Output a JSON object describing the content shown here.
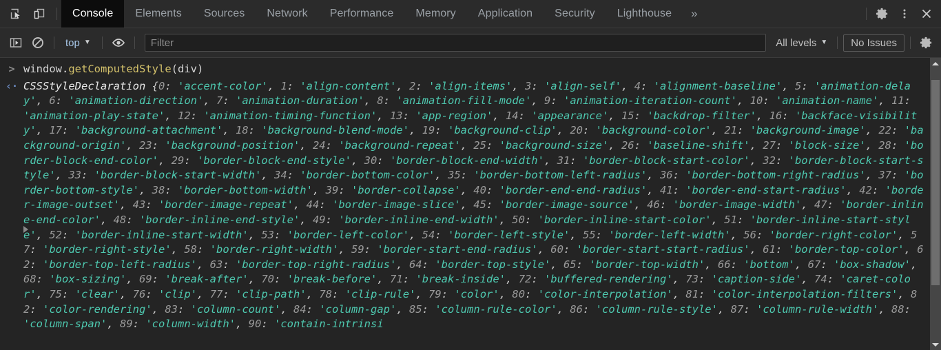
{
  "tabbar": {
    "inspect_icon": "inspect-element-icon",
    "device_icon": "device-toolbar-icon",
    "tabs": [
      {
        "label": "Console",
        "active": true
      },
      {
        "label": "Elements",
        "active": false
      },
      {
        "label": "Sources",
        "active": false
      },
      {
        "label": "Network",
        "active": false
      },
      {
        "label": "Performance",
        "active": false
      },
      {
        "label": "Memory",
        "active": false
      },
      {
        "label": "Application",
        "active": false
      },
      {
        "label": "Security",
        "active": false
      },
      {
        "label": "Lighthouse",
        "active": false
      }
    ],
    "more_tabs_label": "»",
    "settings_icon": "gear-icon",
    "more_options_icon": "kebab-menu-icon",
    "close_icon": "close-icon"
  },
  "toolbar": {
    "sidebar_icon": "console-sidebar-icon",
    "clear_icon": "clear-console-icon",
    "context_label": "top",
    "context_caret": "▼",
    "eye_icon": "live-expression-eye-icon",
    "filter_placeholder": "Filter",
    "filter_value": "",
    "levels_label": "All levels",
    "levels_caret": "▼",
    "issues_label": "No Issues",
    "settings_icon": "console-settings-gear-icon"
  },
  "console": {
    "prompt_symbol": ">",
    "response_symbol": "‹·",
    "command": {
      "object": "window",
      "dot": ".",
      "method": "getComputedStyle",
      "args": "(div)"
    },
    "result": {
      "constructor": "CSSStyleDeclaration ",
      "open_brace": "{",
      "entries": [
        {
          "index": "0",
          "value": "accent-color"
        },
        {
          "index": "1",
          "value": "align-content"
        },
        {
          "index": "2",
          "value": "align-items"
        },
        {
          "index": "3",
          "value": "align-self"
        },
        {
          "index": "4",
          "value": "alignment-baseline"
        },
        {
          "index": "5",
          "value": "animation-delay"
        },
        {
          "index": "6",
          "value": "animation-direction"
        },
        {
          "index": "7",
          "value": "animation-duration"
        },
        {
          "index": "8",
          "value": "animation-fill-mode"
        },
        {
          "index": "9",
          "value": "animation-iteration-count"
        },
        {
          "index": "10",
          "value": "animation-name"
        },
        {
          "index": "11",
          "value": "animation-play-state"
        },
        {
          "index": "12",
          "value": "animation-timing-function"
        },
        {
          "index": "13",
          "value": "app-region"
        },
        {
          "index": "14",
          "value": "appearance"
        },
        {
          "index": "15",
          "value": "backdrop-filter"
        },
        {
          "index": "16",
          "value": "backface-visibility"
        },
        {
          "index": "17",
          "value": "background-attachment"
        },
        {
          "index": "18",
          "value": "background-blend-mode"
        },
        {
          "index": "19",
          "value": "background-clip"
        },
        {
          "index": "20",
          "value": "background-color"
        },
        {
          "index": "21",
          "value": "background-image"
        },
        {
          "index": "22",
          "value": "background-origin"
        },
        {
          "index": "23",
          "value": "background-position"
        },
        {
          "index": "24",
          "value": "background-repeat"
        },
        {
          "index": "25",
          "value": "background-size"
        },
        {
          "index": "26",
          "value": "baseline-shift"
        },
        {
          "index": "27",
          "value": "block-size"
        },
        {
          "index": "28",
          "value": "border-block-end-color"
        },
        {
          "index": "29",
          "value": "border-block-end-style"
        },
        {
          "index": "30",
          "value": "border-block-end-width"
        },
        {
          "index": "31",
          "value": "border-block-start-color"
        },
        {
          "index": "32",
          "value": "border-block-start-style"
        },
        {
          "index": "33",
          "value": "border-block-start-width"
        },
        {
          "index": "34",
          "value": "border-bottom-color"
        },
        {
          "index": "35",
          "value": "border-bottom-left-radius"
        },
        {
          "index": "36",
          "value": "border-bottom-right-radius"
        },
        {
          "index": "37",
          "value": "border-bottom-style"
        },
        {
          "index": "38",
          "value": "border-bottom-width"
        },
        {
          "index": "39",
          "value": "border-collapse"
        },
        {
          "index": "40",
          "value": "border-end-end-radius"
        },
        {
          "index": "41",
          "value": "border-end-start-radius"
        },
        {
          "index": "42",
          "value": "border-image-outset"
        },
        {
          "index": "43",
          "value": "border-image-repeat"
        },
        {
          "index": "44",
          "value": "border-image-slice"
        },
        {
          "index": "45",
          "value": "border-image-source"
        },
        {
          "index": "46",
          "value": "border-image-width"
        },
        {
          "index": "47",
          "value": "border-inline-end-color"
        },
        {
          "index": "48",
          "value": "border-inline-end-style"
        },
        {
          "index": "49",
          "value": "border-inline-end-width"
        },
        {
          "index": "50",
          "value": "border-inline-start-color"
        },
        {
          "index": "51",
          "value": "border-inline-start-style"
        },
        {
          "index": "52",
          "value": "border-inline-start-width"
        },
        {
          "index": "53",
          "value": "border-left-color"
        },
        {
          "index": "54",
          "value": "border-left-style"
        },
        {
          "index": "55",
          "value": "border-left-width"
        },
        {
          "index": "56",
          "value": "border-right-color"
        },
        {
          "index": "57",
          "value": "border-right-style"
        },
        {
          "index": "58",
          "value": "border-right-width"
        },
        {
          "index": "59",
          "value": "border-start-end-radius"
        },
        {
          "index": "60",
          "value": "border-start-start-radius"
        },
        {
          "index": "61",
          "value": "border-top-color"
        },
        {
          "index": "62",
          "value": "border-top-left-radius"
        },
        {
          "index": "63",
          "value": "border-top-right-radius"
        },
        {
          "index": "64",
          "value": "border-top-style"
        },
        {
          "index": "65",
          "value": "border-top-width"
        },
        {
          "index": "66",
          "value": "bottom"
        },
        {
          "index": "67",
          "value": "box-shadow"
        },
        {
          "index": "68",
          "value": "box-sizing"
        },
        {
          "index": "69",
          "value": "break-after"
        },
        {
          "index": "70",
          "value": "break-before"
        },
        {
          "index": "71",
          "value": "break-inside"
        },
        {
          "index": "72",
          "value": "buffered-rendering"
        },
        {
          "index": "73",
          "value": "caption-side"
        },
        {
          "index": "74",
          "value": "caret-color"
        },
        {
          "index": "75",
          "value": "clear"
        },
        {
          "index": "76",
          "value": "clip"
        },
        {
          "index": "77",
          "value": "clip-path"
        },
        {
          "index": "78",
          "value": "clip-rule"
        },
        {
          "index": "79",
          "value": "color"
        },
        {
          "index": "80",
          "value": "color-interpolation"
        },
        {
          "index": "81",
          "value": "color-interpolation-filters"
        },
        {
          "index": "82",
          "value": "color-rendering"
        },
        {
          "index": "83",
          "value": "column-count"
        },
        {
          "index": "84",
          "value": "column-gap"
        },
        {
          "index": "85",
          "value": "column-rule-color"
        },
        {
          "index": "86",
          "value": "column-rule-style"
        },
        {
          "index": "87",
          "value": "column-rule-width"
        },
        {
          "index": "88",
          "value": "column-span"
        },
        {
          "index": "89",
          "value": "column-width"
        },
        {
          "index": "90",
          "value": "contain-intrinsi"
        }
      ],
      "truncated": true
    },
    "expander_symbol": "▶"
  },
  "scrollbar": {
    "up_arrow": "scroll-up-arrow",
    "down_arrow": "scroll-down-arrow",
    "thumb_top_pct": 4,
    "thumb_height_pct": 76
  },
  "colors": {
    "bg": "#242424",
    "chrome": "#2b2b2b",
    "active_tab_bg": "#0c0c0c",
    "string": "#4ec9b0",
    "number": "#9a9a9a",
    "function": "#d2c06a",
    "plain": "#d4d4d4",
    "link": "#a8c7e8"
  }
}
